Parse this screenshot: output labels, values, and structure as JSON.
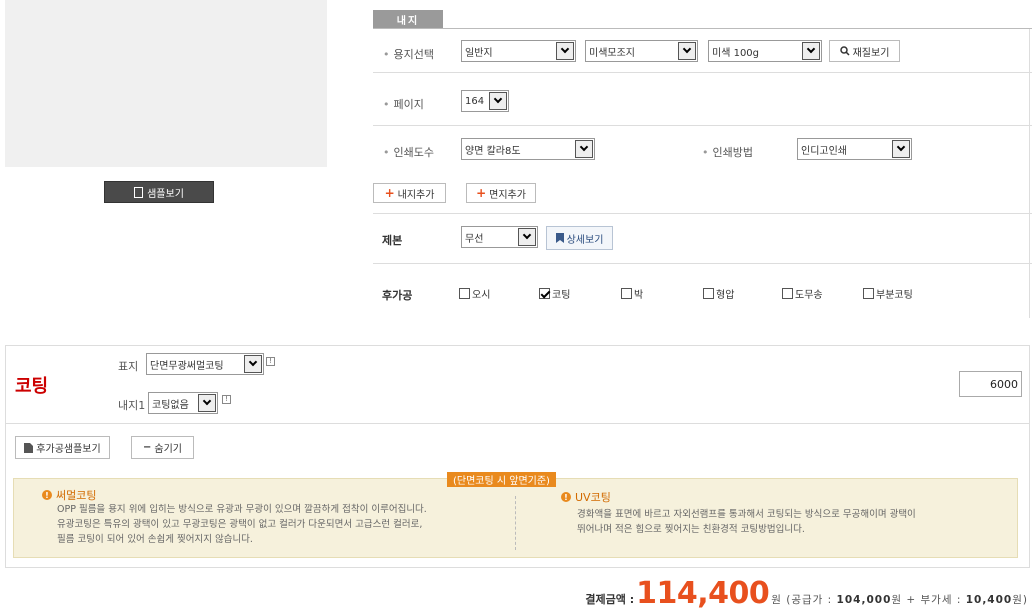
{
  "sample": {
    "label": "샘플보기"
  },
  "inner": {
    "tab": "내지",
    "paper_label": "용지선택",
    "paper_type": "일반지",
    "paper_name": "미색모조지",
    "paper_weight": "미색 100g",
    "material_btn": "재질보기",
    "page_label": "페이지",
    "page_value": "164",
    "color_label": "인쇄도수",
    "color_value": "양면 칼라8도",
    "method_label": "인쇄방법",
    "method_value": "인디고인쇄",
    "add_inner": "내지추가",
    "add_middle": "면지추가"
  },
  "binding": {
    "label": "제본",
    "value": "무선",
    "detail_btn": "상세보기"
  },
  "finishing": {
    "label": "후가공",
    "options": [
      {
        "label": "오시",
        "checked": false
      },
      {
        "label": "코팅",
        "checked": true
      },
      {
        "label": "박",
        "checked": false
      },
      {
        "label": "형압",
        "checked": false
      },
      {
        "label": "도무송",
        "checked": false
      },
      {
        "label": "부분코팅",
        "checked": false
      }
    ]
  },
  "coating": {
    "title": "코팅",
    "cover_label": "표지",
    "cover_value": "단면무광써멀코팅",
    "inner_label": "내지1",
    "inner_value": "코팅없음",
    "quantity": "6000",
    "sample_btn": "후가공샘플보기",
    "hide_btn": "숨기기",
    "tag": "(단면코팅 시 앞면기준)",
    "thermal_title": "써멀코팅",
    "thermal_lines": [
      "OPP 필름을 용지 위에 입히는 방식으로 유광과 무광이 있으며 깔끔하게 접착이 이루어집니다.",
      "유광코팅은 특유의 광택이 있고 무광코팅은 광택이 없고 컬러가 다운되면서 고급스런 컬러로,",
      "필름 코팅이 되어 있어 손쉽게 찢어지지 않습니다."
    ],
    "uv_title": "UV코팅",
    "uv_lines": [
      "경화액을 표면에 바르고 자외선램프를 통과해서 코팅되는 방식으로 무공해이며 광택이",
      "뛰어나며 적은 힘으로 찢어지는 친환경적 코팅방법입니다."
    ]
  },
  "total": {
    "label": "결제금액 :",
    "amount": "114,400",
    "suffix": "원 (공급가 : ",
    "supply": "104,000",
    "vat_prefix": "원 + 부가세 : ",
    "vat": "10,400",
    "close": "원)"
  },
  "colors": {
    "accent": "#e8501e",
    "coating_title": "#cc0000",
    "info_bg": "#f6f1dc"
  }
}
